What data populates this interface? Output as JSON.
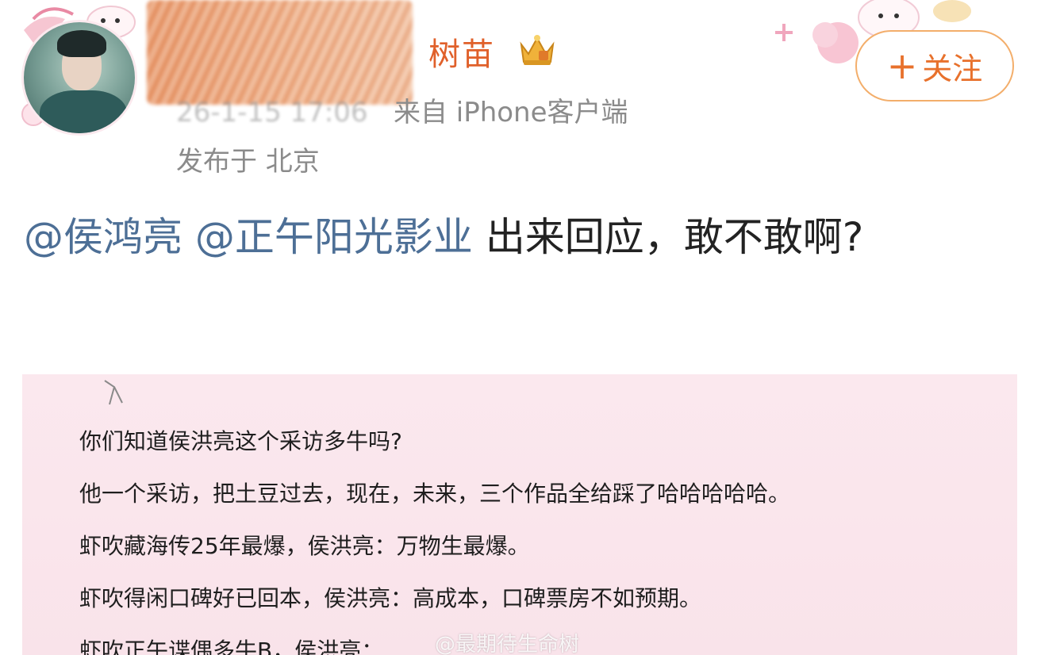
{
  "post": {
    "author": {
      "name": "树苗",
      "badge_icon": "crown-icon"
    },
    "meta": {
      "timestamp": "26-1-15 17:06",
      "source": "来自 iPhone客户端",
      "location": "发布于 北京"
    },
    "follow_button": {
      "label": "关注",
      "icon": "plus-icon"
    },
    "content": {
      "mention_1": "@侯鸿亮",
      "mention_2": "@正午阳光影业",
      "text": " 出来回应，敢不敢啊?"
    }
  },
  "image_card": {
    "lines": [
      "你们知道侯洪亮这个采访多牛吗?",
      "他一个采访，把土豆过去，现在，未来，三个作品全给踩了哈哈哈哈哈。",
      "虾吹藏海传25年最爆，侯洪亮：万物生最爆。",
      "虾吹得闲口碑好已回本，侯洪亮：高成本，口碑票房不如预期。",
      "虾吹正午谍偶多牛B，侯洪亮："
    ],
    "watermark": "@最期待生命树"
  },
  "colors": {
    "mention": "#4d6f96",
    "username": "#e0602a",
    "follow_border": "#f3ae6b",
    "card_bg": "#fbe8ee"
  }
}
